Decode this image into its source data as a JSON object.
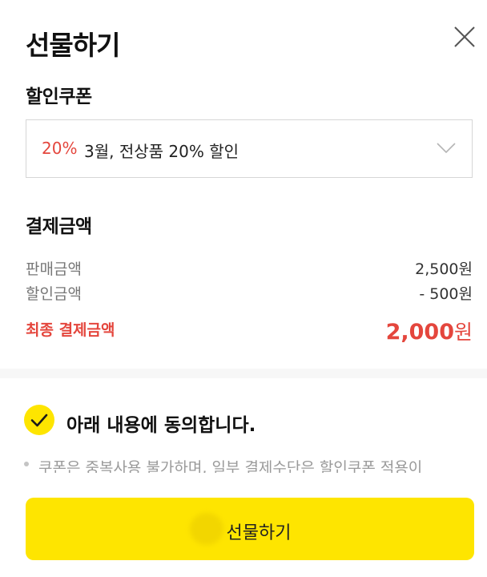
{
  "header": {
    "title": "선물하기",
    "close_icon": "close-icon"
  },
  "coupon": {
    "section_label": "할인쿠폰",
    "selected_rate": "20%",
    "selected_name": "3월, 전상품 20% 할인",
    "dropdown_icon": "chevron-down-icon"
  },
  "payment": {
    "section_label": "결제금액",
    "rows": [
      {
        "label": "판매금액",
        "value": "2,500원"
      },
      {
        "label": "할인금액",
        "value": "- 500원"
      }
    ],
    "final_label": "최종 결제금액",
    "final_amount": "2,000",
    "final_unit": "원"
  },
  "agreement": {
    "check_icon": "check-circle-icon",
    "label": "아래 내용에 동의합니다.",
    "notice_text": "쿠폰은 중복사용 불가하며, 일부 결제수단은 할인쿠폰 적용이"
  },
  "submit": {
    "label": "선물하기"
  },
  "colors": {
    "accent": "#fee500",
    "discount_red": "#e4463d"
  }
}
